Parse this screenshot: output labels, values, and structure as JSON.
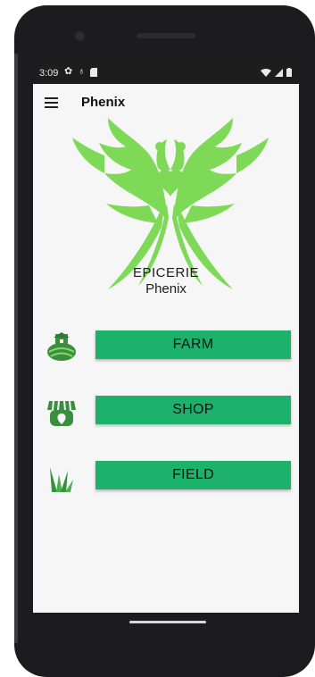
{
  "status": {
    "time": "3:09",
    "icons_left": [
      "settings-gear",
      "accessibility",
      "sd-card"
    ],
    "icons_right": [
      "wifi",
      "signal",
      "battery"
    ]
  },
  "app": {
    "title": "Phenix",
    "menu_icon": "hamburger-menu"
  },
  "logo": {
    "line1": "EPICERIE",
    "line2": "Phenix",
    "color": "#7ed957"
  },
  "actions": [
    {
      "label": "FARM",
      "icon": "farm-icon"
    },
    {
      "label": "SHOP",
      "icon": "shop-icon"
    },
    {
      "label": "FIELD",
      "icon": "grass-icon"
    }
  ],
  "colors": {
    "button": "#1cb26b",
    "accent_green": "#7ed957",
    "icon_green": "#3a8f3f"
  }
}
